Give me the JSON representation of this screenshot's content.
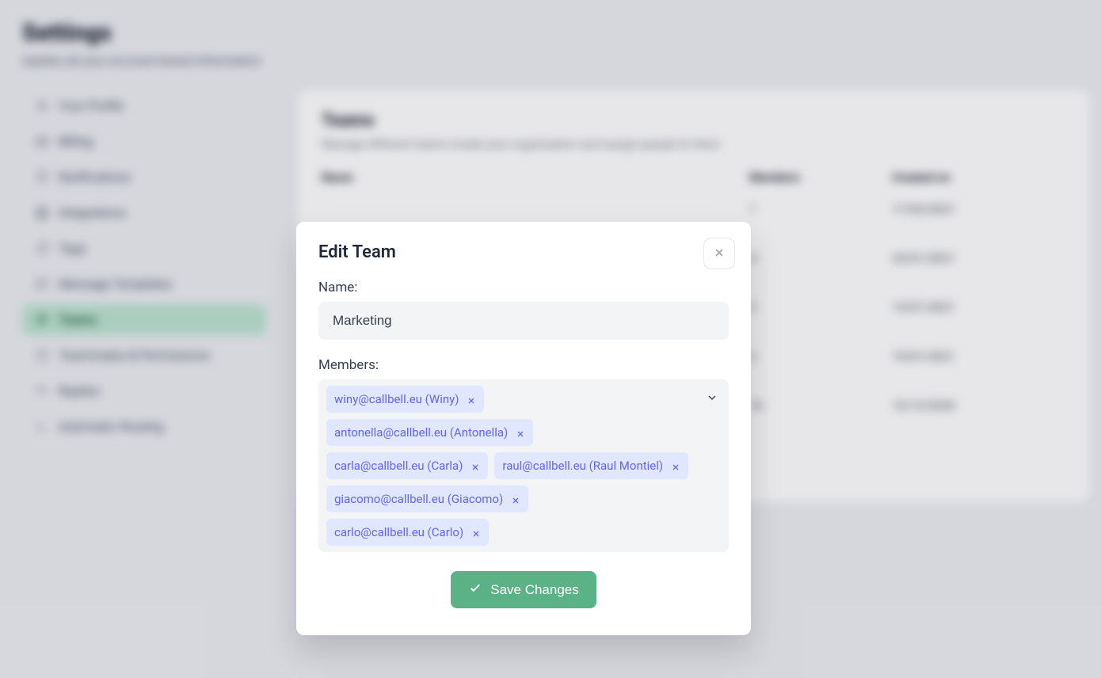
{
  "page": {
    "title": "Settings",
    "subtitle": "Update all your account based information"
  },
  "sidebar": {
    "items": [
      {
        "label": "Your Profile"
      },
      {
        "label": "Billing"
      },
      {
        "label": "Notifications"
      },
      {
        "label": "Integrations"
      },
      {
        "label": "Tags"
      },
      {
        "label": "Message Templates"
      },
      {
        "label": "Teams"
      },
      {
        "label": "Teammates & Permissions"
      },
      {
        "label": "Replies"
      },
      {
        "label": "Automatic Routing"
      }
    ]
  },
  "teamsPanel": {
    "title": "Teams",
    "subtitle": "Manage different teams inside your organization and assign people to them",
    "columns": {
      "name": "Name",
      "members": "Members",
      "created": "Created on"
    },
    "rows": [
      {
        "name": "",
        "members": "1",
        "created": "17/03/2021"
      },
      {
        "name": "",
        "members": "4",
        "created": "25/01/2021"
      },
      {
        "name": "",
        "members": "2",
        "created": "13/01/2021"
      },
      {
        "name": "",
        "members": "2",
        "created": "19/01/2021"
      },
      {
        "name": "",
        "members": "16",
        "created": "14/12/2020"
      }
    ]
  },
  "modal": {
    "title": "Edit Team",
    "nameLabel": "Name:",
    "nameValue": "Marketing",
    "membersLabel": "Members:",
    "members": [
      "winy@callbell.eu (Winy)",
      "antonella@callbell.eu (Antonella)",
      "carla@callbell.eu (Carla)",
      "raul@callbell.eu (Raul Montiel)",
      "giacomo@callbell.eu (Giacomo)",
      "carlo@callbell.eu (Carlo)"
    ],
    "saveLabel": "Save Changes"
  }
}
